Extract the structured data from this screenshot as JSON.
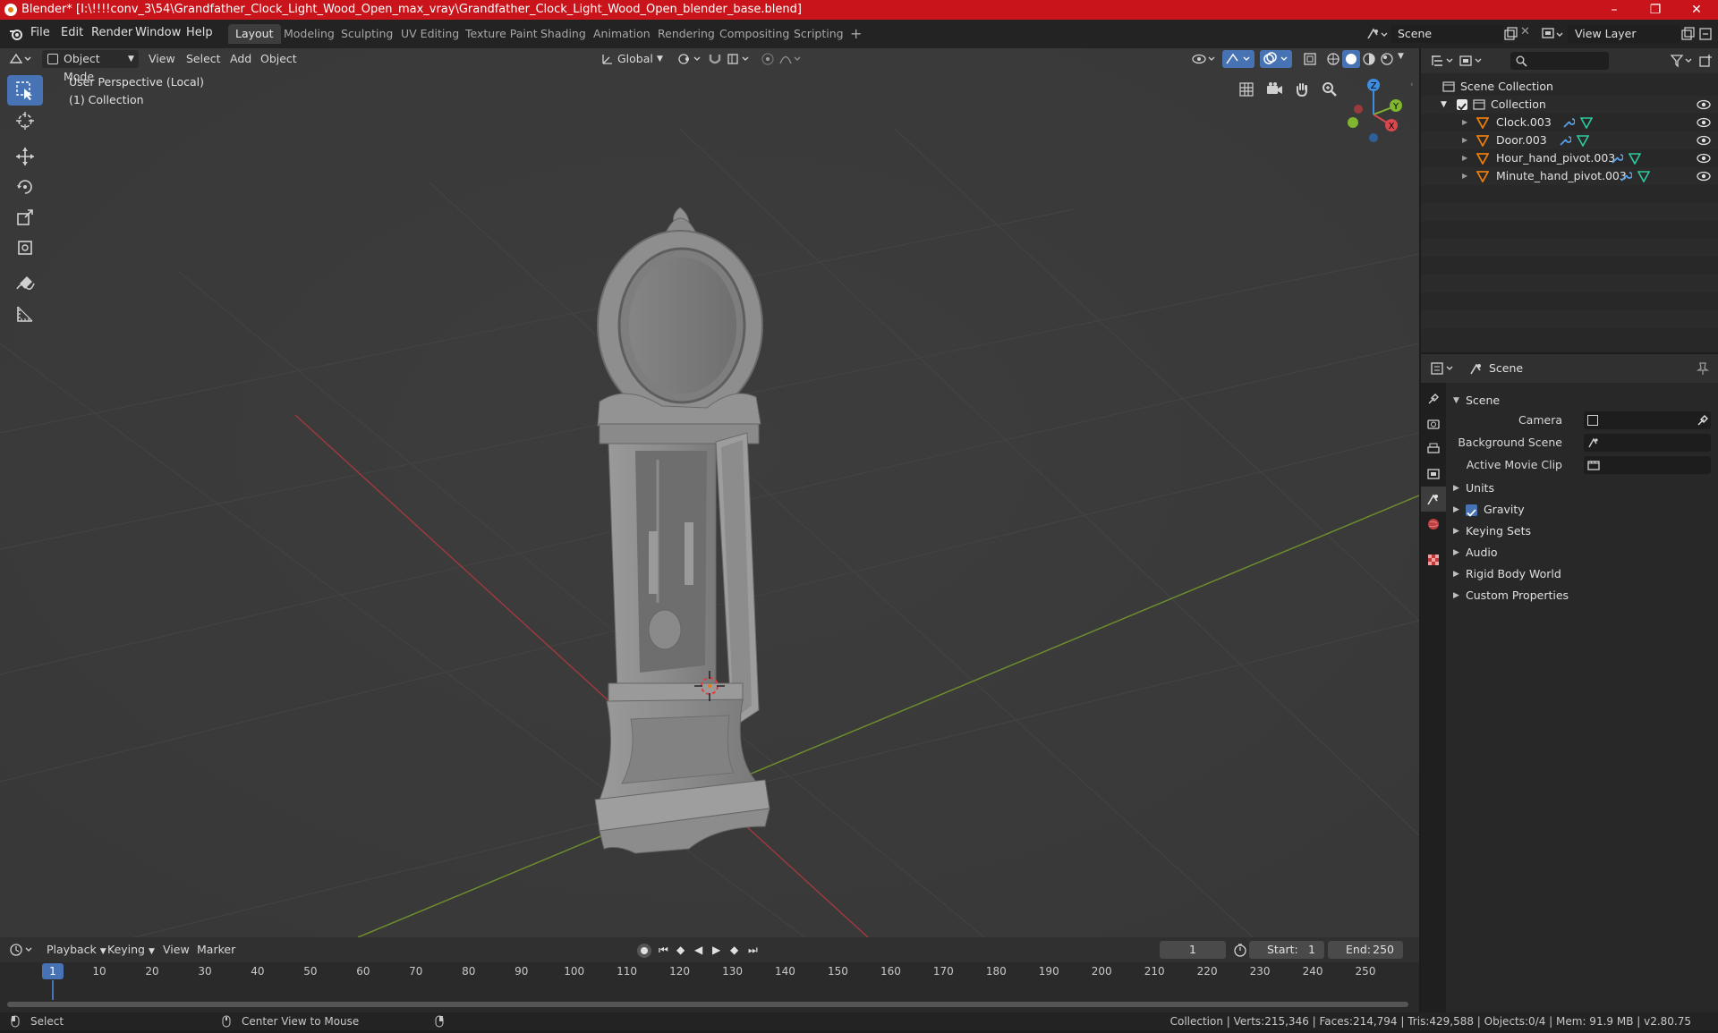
{
  "window": {
    "title": "Blender* [I:\\!!!!conv_3\\54\\Grandfather_Clock_Light_Wood_Open_max_vray\\Grandfather_Clock_Light_Wood_Open_blender_base.blend]",
    "minimize": "–",
    "maximize": "❐",
    "close": "✕"
  },
  "menu": {
    "items": [
      "File",
      "Edit",
      "Render",
      "Window",
      "Help"
    ]
  },
  "workspaces": {
    "tabs": [
      "Layout",
      "Modeling",
      "Sculpting",
      "UV Editing",
      "Texture Paint",
      "Shading",
      "Animation",
      "Rendering",
      "Compositing",
      "Scripting"
    ],
    "active": "Layout",
    "add": "+"
  },
  "scene_selector": {
    "value": "Scene"
  },
  "view_layer_selector": {
    "value": "View Layer"
  },
  "viewport": {
    "mode": "Object Mode",
    "menus": [
      "View",
      "Select",
      "Add",
      "Object"
    ],
    "transform_orientation": "Global",
    "perspective_label": "User Perspective (Local)",
    "collection_label": "(1) Collection",
    "gizmo": {
      "x": "X",
      "y": "Y",
      "z": "Z"
    }
  },
  "outliner": {
    "root": "Scene Collection",
    "collection": "Collection",
    "objects": [
      "Clock.003",
      "Door.003",
      "Hour_hand_pivot.003",
      "Minute_hand_pivot.003"
    ],
    "search_placeholder": ""
  },
  "properties": {
    "context": "Scene",
    "panel_title": "Scene",
    "fields": [
      {
        "label": "Camera",
        "value": ""
      },
      {
        "label": "Background Scene",
        "value": ""
      },
      {
        "label": "Active Movie Clip",
        "value": ""
      }
    ],
    "panels": [
      "Units",
      "Gravity",
      "Keying Sets",
      "Audio",
      "Rigid Body World",
      "Custom Properties"
    ],
    "gravity_checked": true
  },
  "timeline": {
    "menus": [
      "Playback",
      "Keying",
      "View",
      "Marker"
    ],
    "current_frame": "1",
    "start_label": "Start:",
    "start": "1",
    "end_label": "End:",
    "end": "250",
    "ticks": [
      "1",
      "10",
      "20",
      "30",
      "40",
      "50",
      "60",
      "70",
      "80",
      "90",
      "100",
      "110",
      "120",
      "130",
      "140",
      "150",
      "160",
      "170",
      "180",
      "190",
      "200",
      "210",
      "220",
      "230",
      "240",
      "250"
    ]
  },
  "status": {
    "select": "Select",
    "center_view": "Center View to Mouse",
    "stats": "Collection | Verts:215,346 | Faces:214,794 | Tris:429,588 | Objects:0/4 | Mem: 91.9 MB | v2.80.75"
  },
  "colors": {
    "title_bar": "#c8141a",
    "active_tool": "#4772b3",
    "axis_x": "#d9484f",
    "axis_y": "#7fb52f",
    "axis_z": "#3d8ee0",
    "mesh_icon": "#e87d0d",
    "modifier_icon": "#5aa0e8",
    "data_icon": "#2ec9a0"
  }
}
